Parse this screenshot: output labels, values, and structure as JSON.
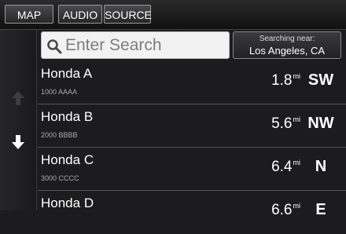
{
  "tabs": [
    {
      "label": "MAP"
    },
    {
      "label": "AUDIO"
    },
    {
      "label": "SOURCE"
    }
  ],
  "search": {
    "placeholder": "Enter Search"
  },
  "near": {
    "label": "Searching near:",
    "location": "Los Angeles, CA"
  },
  "results": [
    {
      "name": "Honda A",
      "address": "1000 AAAA",
      "distance": "1.8",
      "unit": "mi",
      "direction": "SW"
    },
    {
      "name": "Honda B",
      "address": "2000 BBBB",
      "distance": "5.6",
      "unit": "mi",
      "direction": "NW"
    },
    {
      "name": "Honda C",
      "address": "3000 CCCC",
      "distance": "6.4",
      "unit": "mi",
      "direction": "N"
    },
    {
      "name": "Honda D",
      "address": "",
      "distance": "6.6",
      "unit": "mi",
      "direction": "E"
    }
  ],
  "icons": {
    "search": "search-icon",
    "scroll_up": "arrow-up-icon",
    "scroll_down": "arrow-down-icon"
  }
}
